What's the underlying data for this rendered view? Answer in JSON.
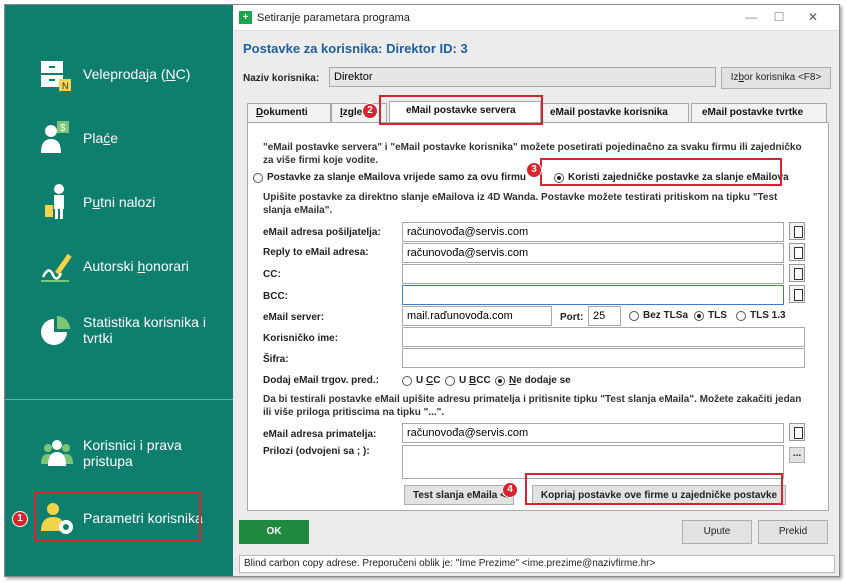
{
  "sidebar": {
    "items": [
      {
        "label_pre": "Veleprodaja (",
        "label_u": "N",
        "label_post": "C)",
        "icon": "cash-register-icon"
      },
      {
        "label_pre": "Pla",
        "label_u": "ć",
        "label_post": "e",
        "icon": "payroll-icon"
      },
      {
        "label_pre": "P",
        "label_u": "u",
        "label_post": "tni nalozi",
        "icon": "traveler-icon"
      },
      {
        "label_pre": "Autorski ",
        "label_u": "h",
        "label_post": "onorari",
        "icon": "pen-signature-icon"
      },
      {
        "label_pre": "Statistika korisnika i tvrtki",
        "label_u": "",
        "label_post": "",
        "icon": "pie-chart-icon"
      }
    ],
    "bottom_items": [
      {
        "label": "Korisnici i prava pristupa",
        "icon": "users-icon"
      },
      {
        "label": "Parametri korisnika",
        "icon": "user-settings-icon"
      }
    ]
  },
  "window": {
    "title": "Setiranje parametara programa",
    "header": "Postavke za korisnika: Direktor ID: 3",
    "user_name_label": "Naziv korisnika:",
    "user_name_value": "Direktor",
    "pick_user_button_pre": "Iz",
    "pick_user_button_u": "b",
    "pick_user_button_post": "or korisnika <F8>"
  },
  "tabs": [
    {
      "pre": "",
      "u": "D",
      "post": "okumenti"
    },
    {
      "pre": "",
      "u": "I",
      "post": "zgled"
    },
    {
      "pre": "eMail postavke servera",
      "u": "",
      "post": ""
    },
    {
      "pre": "eMail postavke korisnika",
      "u": "",
      "post": ""
    },
    {
      "pre": "eMail postavke tvrtke",
      "u": "",
      "post": ""
    }
  ],
  "panel": {
    "intro": "\"eMail postavke servera\" i \"eMail postavke korisnika\" možete posetirati pojedinačno za svaku firmu ili zajedničko za više firmi koje vodite.",
    "radio_this_firm": "Postavke za slanje eMailova vrijede samo za ovu firmu",
    "radio_shared": "Koristi zajedničke postavke za slanje eMailova",
    "instructions": "Upišite postavke za direktno slanje eMailova iz 4D Wanda. Postavke možete testirati pritiskom na tipku \"Test slanja eMaila\".",
    "fields": {
      "sender_label": "eMail adresa pošiljatelja:",
      "sender_value": "računovođa@servis.com",
      "replyto_label": "Reply to eMail adresa:",
      "replyto_value": "računovođa@servis.com",
      "cc_label": "CC:",
      "cc_value": "",
      "bcc_label": "BCC:",
      "bcc_value": "",
      "server_label": "eMail server:",
      "server_value": "mail.raďunovođa.com",
      "port_label": "Port:",
      "port_value": "25",
      "tls_none": "Bez TLSa",
      "tls": "TLS",
      "tls13": "TLS 1.3",
      "username_label": "Korisničko ime:",
      "username_value": "",
      "password_label": "Šifra:",
      "password_value": "",
      "addtrade_label": "Dodaj eMail trgov. pred.:",
      "opt_cc_pre": "U ",
      "opt_cc_u": "C",
      "opt_cc_post": "C",
      "opt_bcc_pre": "U ",
      "opt_bcc_u": "B",
      "opt_bcc_post": "CC",
      "opt_none_pre": "",
      "opt_none_u": "N",
      "opt_none_post": "e dodaje se"
    },
    "test_intro": "Da bi testirali postavke eMail upišite adresu primatelja i pritisnite tipku \"Test slanja eMaila\". Možete zakačiti jedan ili više priloga pritiscima na tipku \"...\".",
    "recipient_label": "eMail adresa primatelja:",
    "recipient_value": "računovođa@servis.com",
    "attachments_label": "Prilozi (odvojeni sa ; ):",
    "dots_button": "...",
    "test_button": "Test slanja eMaila <F",
    "copy_button": "Kopriaj postavke ove firme u zajedničke postavke"
  },
  "footer": {
    "ok": "OK",
    "help": "Upute",
    "cancel": "Prekid",
    "status": "Blind carbon copy adrese. Preporučeni oblik je: \"Ime Prezime\" <ime.prezime@nazivfirme.hr>"
  },
  "badges": [
    "1",
    "2",
    "3",
    "4"
  ],
  "colors": {
    "sidebar": "#0f7f6d",
    "accent": "#1f5fa0",
    "ok": "#1f8a3f",
    "highlight": "#d9232e"
  }
}
